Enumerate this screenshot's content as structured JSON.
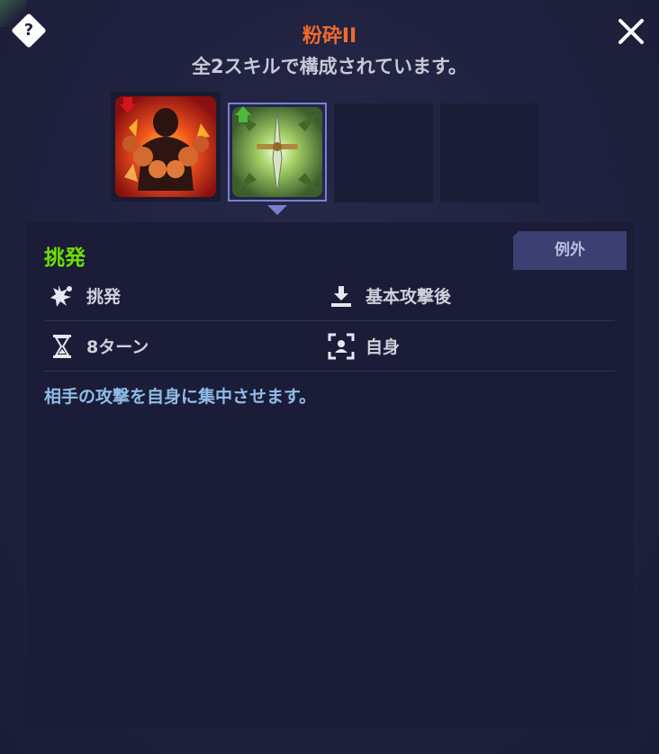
{
  "header": {
    "title": "粉砕II",
    "subtitle": "全2スキルで構成されています。",
    "help_icon": "?"
  },
  "slots": [
    {
      "icon": "fists-flame-icon",
      "indicator": "red-down-arrow",
      "state": "normal"
    },
    {
      "icon": "sword-taunt-icon",
      "indicator": "green-up-arrow",
      "state": "selected"
    },
    {
      "icon": "",
      "state": "empty"
    },
    {
      "icon": "",
      "state": "empty"
    }
  ],
  "skill": {
    "name": "挑発",
    "tag": "例外",
    "effect_type": "挑発",
    "timing": "基本攻撃後",
    "duration": "8ターン",
    "target": "自身",
    "description": "相手の攻撃を自身に集中させます。"
  },
  "colors": {
    "title": "#ef6a2c",
    "skill_name": "#6ce000",
    "description": "#8fbde6",
    "selected_border": "#7b7fd0"
  }
}
